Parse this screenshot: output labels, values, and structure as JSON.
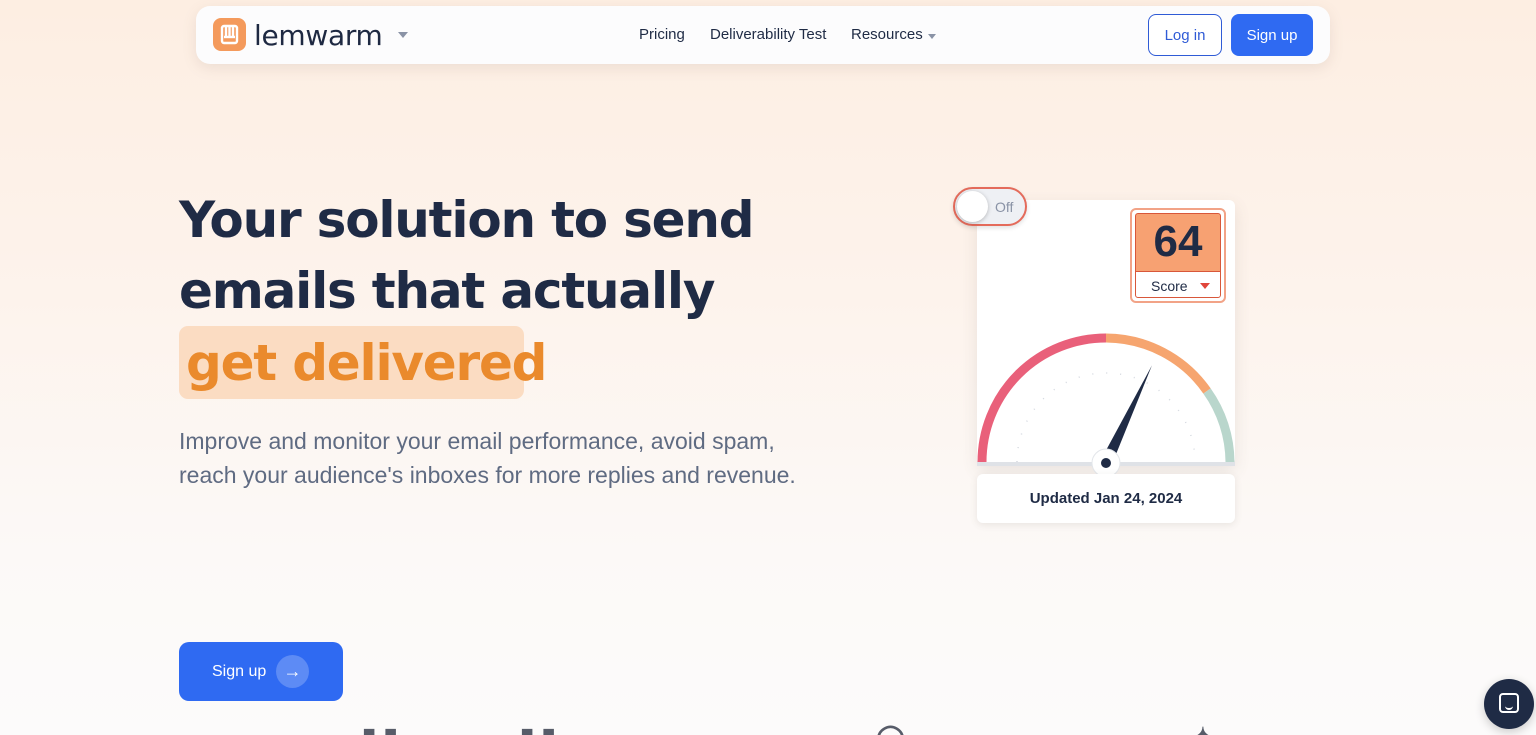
{
  "nav": {
    "brand": "lemwarm",
    "links": [
      {
        "label": "Pricing"
      },
      {
        "label": "Deliverability Test"
      },
      {
        "label": "Resources"
      }
    ],
    "login": "Log in",
    "signup": "Sign up"
  },
  "hero": {
    "line1": "Your solution to send",
    "line2": "emails that actually",
    "highlight": "get delivered",
    "subtitle": "Improve and monitor your email performance, avoid spam, reach your audience's inboxes for more replies and revenue.",
    "cta": "Sign up"
  },
  "widget": {
    "toggle": "Off",
    "score": "64",
    "score_label": "Score",
    "updated": "Updated Jan 24, 2024",
    "gauge_fraction": 0.64
  },
  "colors": {
    "primary": "#2f6af2",
    "accent": "#ea8a2c",
    "highlight_bg": "#fbdcc2",
    "gauge_red": "#e9607a",
    "gauge_orange": "#f6a56f",
    "gauge_teal": "#b9d6cc"
  }
}
